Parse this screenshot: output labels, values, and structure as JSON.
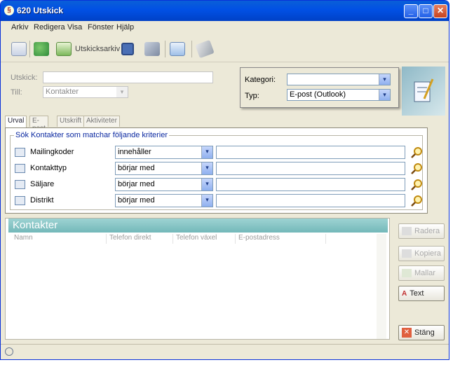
{
  "window": {
    "title": "620 Utskick"
  },
  "menu": [
    "Arkiv",
    "Redigera",
    "Visa",
    "Fönster",
    "Hjälp"
  ],
  "toolbar": {
    "utskicksarkiv_label": "Utskicksarkiv"
  },
  "form": {
    "utskick_label": "Utskick:",
    "utskick_value": "",
    "till_label": "Till:",
    "till_value": "Kontakter"
  },
  "popup": {
    "kategori_label": "Kategori:",
    "kategori_value": "",
    "typ_label": "Typ:",
    "typ_value": "E-post (Outlook)"
  },
  "tabs": [
    "Urval",
    "E-post",
    "Utskrift",
    "Aktiviteter"
  ],
  "criteria": {
    "legend": "Sök Kontakter som matchar följande kriterier",
    "rows": [
      {
        "label": "Mailingkoder",
        "operator": "innehåller",
        "value": ""
      },
      {
        "label": "Kontakttyp",
        "operator": "börjar med",
        "value": ""
      },
      {
        "label": "Säljare",
        "operator": "börjar med",
        "value": ""
      },
      {
        "label": "Distrikt",
        "operator": "börjar med",
        "value": ""
      }
    ]
  },
  "list": {
    "title": "Kontakter",
    "columns": [
      "Namn",
      "Telefon direkt",
      "Telefon växel",
      "E-postadress"
    ]
  },
  "side_buttons": {
    "radera": "Radera",
    "kopiera": "Kopiera",
    "hall": "Mallar",
    "text": "Text",
    "stang": "Stäng"
  }
}
